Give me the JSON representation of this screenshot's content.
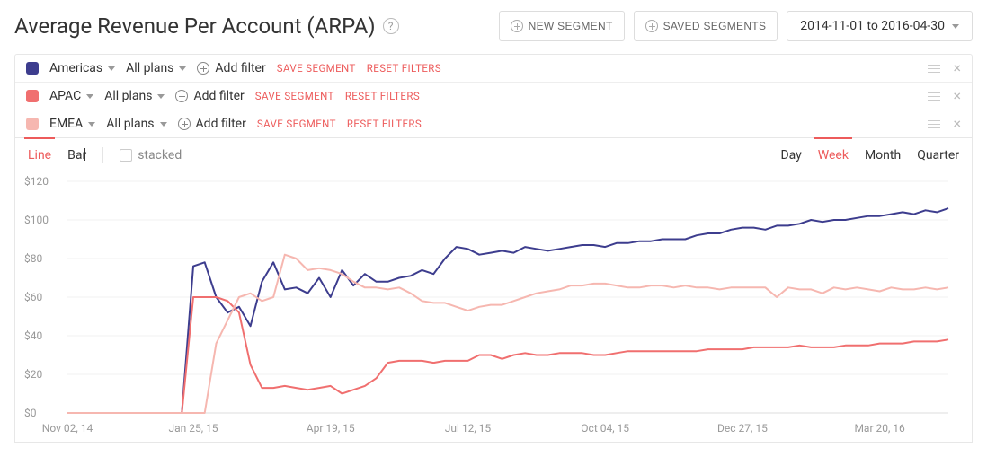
{
  "header": {
    "title": "Average Revenue Per Account (ARPA)",
    "new_segment": "NEW SEGMENT",
    "saved_segments": "SAVED SEGMENTS",
    "date_range": "2014-11-01 to 2016-04-30"
  },
  "segments": [
    {
      "color": "#3d3d8e",
      "name": "Americas",
      "plans": "All plans",
      "add_filter": "Add filter",
      "save": "SAVE SEGMENT",
      "reset": "RESET FILTERS"
    },
    {
      "color": "#f06f6f",
      "name": "APAC",
      "plans": "All plans",
      "add_filter": "Add filter",
      "save": "SAVE SEGMENT",
      "reset": "RESET FILTERS"
    },
    {
      "color": "#f6b7b0",
      "name": "EMEA",
      "plans": "All plans",
      "add_filter": "Add filter",
      "save": "SAVE SEGMENT",
      "reset": "RESET FILTERS"
    }
  ],
  "chart_controls": {
    "type_line": "Line",
    "type_bar": "Bar",
    "stacked": "stacked",
    "agg_day": "Day",
    "agg_week": "Week",
    "agg_month": "Month",
    "agg_quarter": "Quarter"
  },
  "chart_data": {
    "type": "line",
    "title": "Average Revenue Per Account (ARPA)",
    "xlabel": "",
    "ylabel": "",
    "ylim": [
      0,
      120
    ],
    "y_ticks": [
      0,
      20,
      40,
      60,
      80,
      100,
      120
    ],
    "y_tick_labels": [
      "$0",
      "$20",
      "$40",
      "$60",
      "$80",
      "$100",
      "$120"
    ],
    "x_tick_positions": [
      0,
      11,
      23,
      35,
      47,
      59,
      71
    ],
    "x_tick_labels": [
      "Nov 02, 14",
      "Jan 25, 15",
      "Apr 19, 15",
      "Jul 12, 15",
      "Oct 04, 15",
      "Dec 27, 15",
      "Mar 20, 16"
    ],
    "x_count": 78,
    "series": [
      {
        "name": "Americas",
        "color": "#3d3d8e",
        "values": [
          0,
          0,
          0,
          0,
          0,
          0,
          0,
          0,
          0,
          0,
          0,
          76,
          78,
          60,
          52,
          55,
          45,
          68,
          78,
          64,
          65,
          62,
          70,
          60,
          74,
          66,
          72,
          68,
          68,
          70,
          71,
          74,
          72,
          80,
          86,
          85,
          82,
          83,
          84,
          83,
          86,
          85,
          84,
          85,
          86,
          87,
          87,
          86,
          88,
          88,
          89,
          89,
          90,
          90,
          90,
          92,
          93,
          93,
          95,
          96,
          96,
          95,
          97,
          97,
          98,
          100,
          99,
          100,
          100,
          101,
          102,
          102,
          103,
          104,
          103,
          105,
          104,
          106
        ]
      },
      {
        "name": "APAC",
        "color": "#f06f6f",
        "values": [
          0,
          0,
          0,
          0,
          0,
          0,
          0,
          0,
          0,
          0,
          0,
          60,
          60,
          60,
          58,
          52,
          25,
          13,
          13,
          14,
          13,
          12,
          13,
          14,
          10,
          12,
          14,
          18,
          26,
          27,
          27,
          27,
          26,
          27,
          27,
          27,
          30,
          30,
          28,
          30,
          31,
          30,
          30,
          31,
          31,
          31,
          30,
          30,
          31,
          32,
          32,
          32,
          32,
          32,
          32,
          32,
          33,
          33,
          33,
          33,
          34,
          34,
          34,
          34,
          35,
          34,
          34,
          34,
          35,
          35,
          35,
          36,
          36,
          36,
          37,
          37,
          37,
          38
        ]
      },
      {
        "name": "EMEA",
        "color": "#f6b7b0",
        "values": [
          0,
          0,
          0,
          0,
          0,
          0,
          0,
          0,
          0,
          0,
          0,
          0,
          0,
          36,
          48,
          60,
          62,
          58,
          60,
          82,
          80,
          74,
          75,
          74,
          72,
          68,
          65,
          65,
          64,
          65,
          62,
          58,
          57,
          57,
          55,
          53,
          55,
          56,
          56,
          58,
          60,
          62,
          63,
          64,
          66,
          66,
          67,
          67,
          66,
          65,
          65,
          66,
          66,
          65,
          66,
          65,
          65,
          64,
          65,
          65,
          65,
          65,
          60,
          65,
          64,
          64,
          62,
          65,
          64,
          65,
          64,
          63,
          65,
          64,
          64,
          65,
          64,
          65
        ]
      }
    ]
  }
}
